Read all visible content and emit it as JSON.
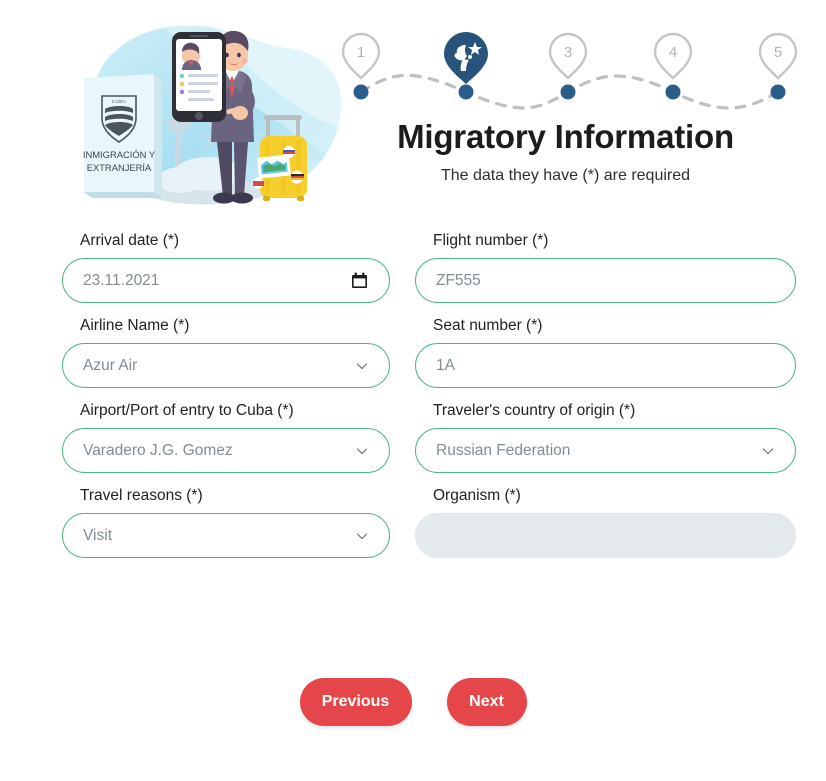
{
  "header": {
    "title": "Migratory Information",
    "subtitle": "The data they have (*) are required"
  },
  "stepper": {
    "active_step": 2,
    "active_color": "#28547c",
    "inactive_color": "#c6c6c6",
    "dot_color": "#2a5d8a",
    "steps": [
      {
        "label": "1",
        "state": "inactive"
      },
      {
        "label": "",
        "state": "active"
      },
      {
        "label": "3",
        "state": "inactive"
      },
      {
        "label": "4",
        "state": "inactive"
      },
      {
        "label": "5",
        "state": "inactive"
      }
    ]
  },
  "illustration": {
    "sign_line1": "INMIGRACIÓN Y",
    "sign_line2": "EXTRANJERÍA",
    "shield_text": "CUBA"
  },
  "form": {
    "rows": [
      {
        "left": {
          "label": "Arrival date (*)",
          "value": "23.11.2021",
          "type": "date",
          "disabled": false
        },
        "right": {
          "label": "Flight number (*)",
          "value": "ZF555",
          "type": "text",
          "disabled": false
        }
      },
      {
        "left": {
          "label": "Airline Name (*)",
          "value": "Azur Air",
          "type": "select",
          "disabled": false
        },
        "right": {
          "label": "Seat number (*)",
          "value": "1A",
          "type": "text",
          "disabled": false
        }
      },
      {
        "left": {
          "label": "Airport/Port of entry to Cuba (*)",
          "value": "Varadero J.G. Gomez",
          "type": "select",
          "disabled": false
        },
        "right": {
          "label": "Traveler's country of origin (*)",
          "value": "Russian Federation",
          "type": "select",
          "disabled": false
        }
      },
      {
        "left": {
          "label": "Travel reasons (*)",
          "value": "Visit",
          "type": "select",
          "disabled": false
        },
        "right": {
          "label": "Organism (*)",
          "value": "",
          "type": "text",
          "disabled": true
        }
      }
    ]
  },
  "actions": {
    "previous_label": "Previous",
    "next_label": "Next",
    "button_color": "#e5464a"
  },
  "colors": {
    "field_border_green": "#4bb77f",
    "value_text_gray": "#828d93",
    "disabled_fill": "#e4e9ec"
  }
}
